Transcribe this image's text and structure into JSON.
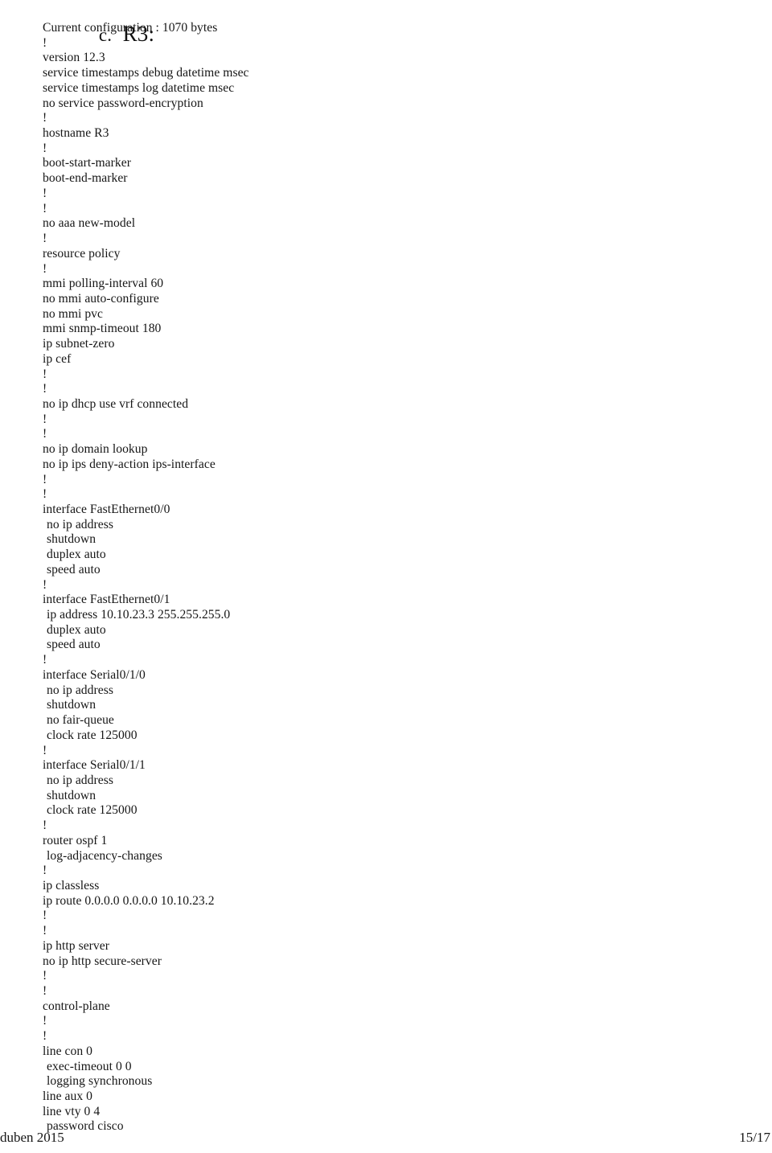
{
  "heading": {
    "marker": "c.",
    "label": "R3:"
  },
  "config": {
    "lines": [
      {
        "text": "Current configuration : 1070 bytes",
        "indent": 0
      },
      {
        "text": "!",
        "indent": 0
      },
      {
        "text": "version 12.3",
        "indent": 0
      },
      {
        "text": "service timestamps debug datetime msec",
        "indent": 0
      },
      {
        "text": "service timestamps log datetime msec",
        "indent": 0
      },
      {
        "text": "no service password-encryption",
        "indent": 0
      },
      {
        "text": "!",
        "indent": 0
      },
      {
        "text": "hostname R3",
        "indent": 0
      },
      {
        "text": "!",
        "indent": 0
      },
      {
        "text": "boot-start-marker",
        "indent": 0
      },
      {
        "text": "boot-end-marker",
        "indent": 0
      },
      {
        "text": "!",
        "indent": 0
      },
      {
        "text": "!",
        "indent": 0
      },
      {
        "text": "no aaa new-model",
        "indent": 0
      },
      {
        "text": "!",
        "indent": 0
      },
      {
        "text": "resource policy",
        "indent": 0
      },
      {
        "text": "!",
        "indent": 0
      },
      {
        "text": "mmi polling-interval 60",
        "indent": 0
      },
      {
        "text": "no mmi auto-configure",
        "indent": 0
      },
      {
        "text": "no mmi pvc",
        "indent": 0
      },
      {
        "text": "mmi snmp-timeout 180",
        "indent": 0
      },
      {
        "text": "ip subnet-zero",
        "indent": 0
      },
      {
        "text": "ip cef",
        "indent": 0
      },
      {
        "text": "!",
        "indent": 0
      },
      {
        "text": "!",
        "indent": 0
      },
      {
        "text": "no ip dhcp use vrf connected",
        "indent": 0
      },
      {
        "text": "!",
        "indent": 0
      },
      {
        "text": "!",
        "indent": 0
      },
      {
        "text": "no ip domain lookup",
        "indent": 0
      },
      {
        "text": "no ip ips deny-action ips-interface",
        "indent": 0
      },
      {
        "text": "!",
        "indent": 0
      },
      {
        "text": "!",
        "indent": 0
      },
      {
        "text": "interface FastEthernet0/0",
        "indent": 0
      },
      {
        "text": "no ip address",
        "indent": 1
      },
      {
        "text": "shutdown",
        "indent": 1
      },
      {
        "text": "duplex auto",
        "indent": 1
      },
      {
        "text": "speed auto",
        "indent": 1
      },
      {
        "text": "!",
        "indent": 0
      },
      {
        "text": "interface FastEthernet0/1",
        "indent": 0
      },
      {
        "text": "ip address 10.10.23.3 255.255.255.0",
        "indent": 1
      },
      {
        "text": "duplex auto",
        "indent": 1
      },
      {
        "text": "speed auto",
        "indent": 1
      },
      {
        "text": "!",
        "indent": 0
      },
      {
        "text": "interface Serial0/1/0",
        "indent": 0
      },
      {
        "text": "no ip address",
        "indent": 1
      },
      {
        "text": "shutdown",
        "indent": 1
      },
      {
        "text": "no fair-queue",
        "indent": 1
      },
      {
        "text": "clock rate 125000",
        "indent": 1
      },
      {
        "text": "!",
        "indent": 0
      },
      {
        "text": "interface Serial0/1/1",
        "indent": 0
      },
      {
        "text": "no ip address",
        "indent": 1
      },
      {
        "text": "shutdown",
        "indent": 1
      },
      {
        "text": "clock rate 125000",
        "indent": 1
      },
      {
        "text": "!",
        "indent": 0
      },
      {
        "text": "router ospf 1",
        "indent": 0
      },
      {
        "text": "log-adjacency-changes",
        "indent": 1
      },
      {
        "text": "!",
        "indent": 0
      },
      {
        "text": "ip classless",
        "indent": 0
      },
      {
        "text": "ip route 0.0.0.0 0.0.0.0 10.10.23.2",
        "indent": 0
      },
      {
        "text": "!",
        "indent": 0
      },
      {
        "text": "!",
        "indent": 0
      },
      {
        "text": "ip http server",
        "indent": 0
      },
      {
        "text": "no ip http secure-server",
        "indent": 0
      },
      {
        "text": "!",
        "indent": 0
      },
      {
        "text": "!",
        "indent": 0
      },
      {
        "text": "control-plane",
        "indent": 0
      },
      {
        "text": "!",
        "indent": 0
      },
      {
        "text": "!",
        "indent": 0
      },
      {
        "text": "line con 0",
        "indent": 0
      },
      {
        "text": "exec-timeout 0 0",
        "indent": 1
      },
      {
        "text": "logging synchronous",
        "indent": 1
      },
      {
        "text": "line aux 0",
        "indent": 0
      },
      {
        "text": "line vty 0 4",
        "indent": 0
      },
      {
        "text": "password cisco",
        "indent": 1
      }
    ]
  },
  "footer": {
    "left": "duben 2015",
    "right": "15/17"
  }
}
